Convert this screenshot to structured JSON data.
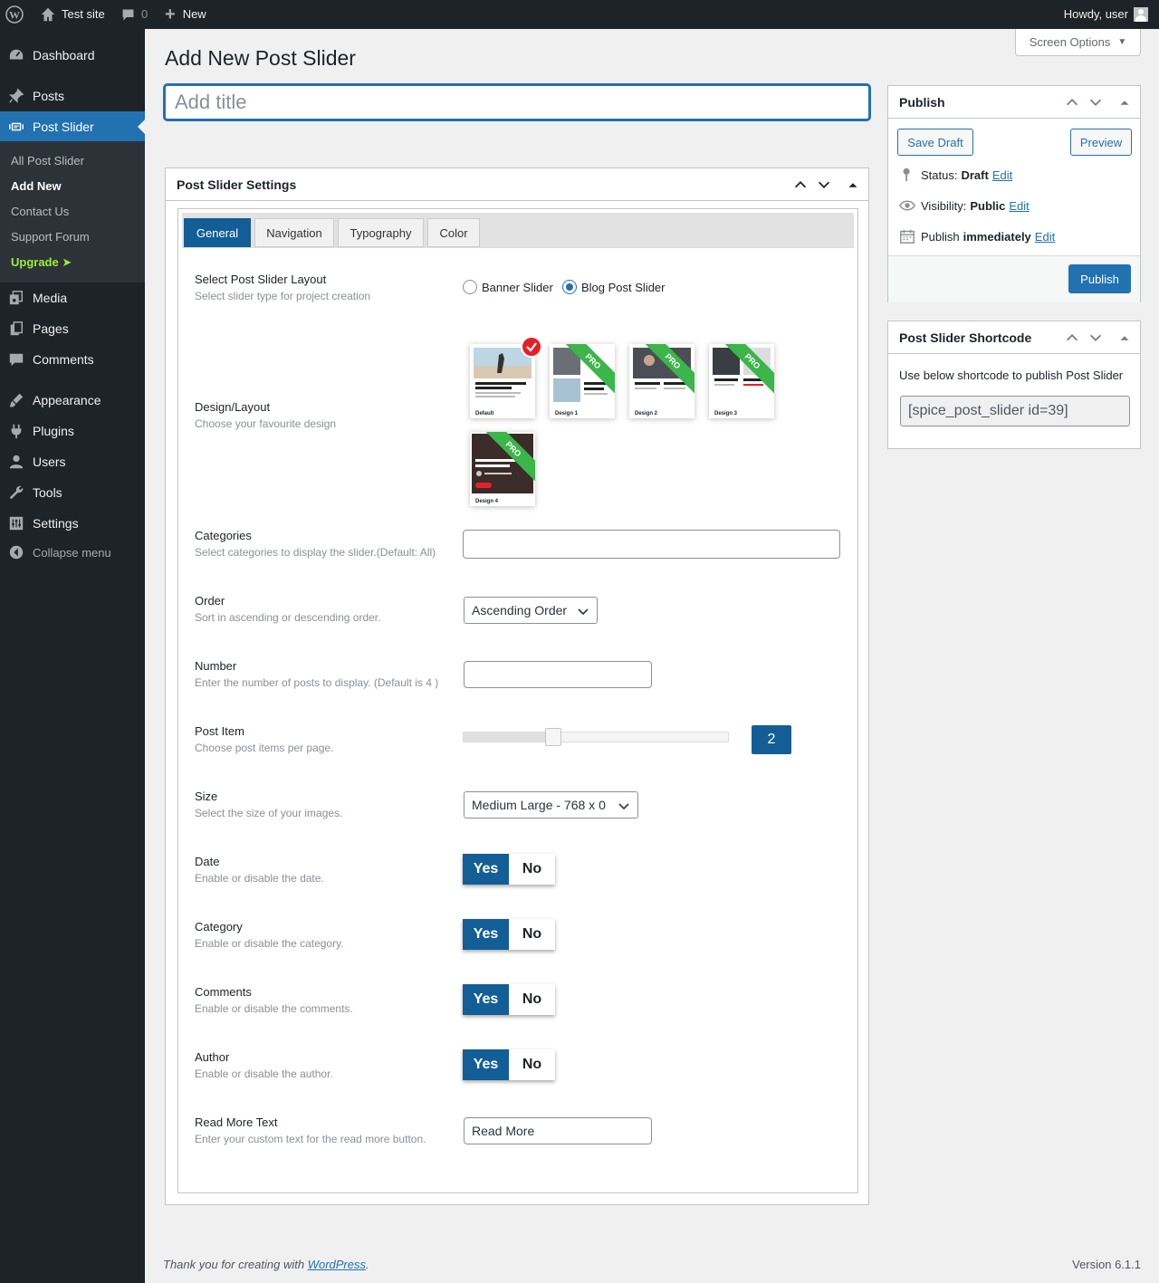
{
  "adminbar": {
    "site_name": "Test site",
    "comments_count": "0",
    "new_label": "New",
    "howdy": "Howdy, user"
  },
  "menu": {
    "items": [
      {
        "label": "Dashboard"
      },
      {
        "label": "Posts"
      },
      {
        "label": "Post Slider"
      },
      {
        "label": "Media"
      },
      {
        "label": "Pages"
      },
      {
        "label": "Comments"
      },
      {
        "label": "Appearance"
      },
      {
        "label": "Plugins"
      },
      {
        "label": "Users"
      },
      {
        "label": "Tools"
      },
      {
        "label": "Settings"
      },
      {
        "label": "Collapse menu"
      }
    ],
    "submenu": [
      {
        "label": "All Post Slider"
      },
      {
        "label": "Add New"
      },
      {
        "label": "Contact Us"
      },
      {
        "label": "Support Forum"
      },
      {
        "label": "Upgrade ➤"
      }
    ]
  },
  "screen_options": "Screen Options",
  "page_title": "Add New Post Slider",
  "title_placeholder": "Add title",
  "settings": {
    "title": "Post Slider Settings",
    "tabs": [
      "General",
      "Navigation",
      "Typography",
      "Color"
    ],
    "layout": {
      "label": "Select Post Slider Layout",
      "desc": "Select slider type for project creation",
      "options": [
        "Banner Slider",
        "Blog Post Slider"
      ],
      "selected": "Blog Post Slider"
    },
    "design": {
      "label": "Design/Layout",
      "desc": "Choose your favourite design",
      "items": [
        {
          "name": "Default",
          "pro": false,
          "selected": true
        },
        {
          "name": "Design 1",
          "pro": true
        },
        {
          "name": "Design 2",
          "pro": true
        },
        {
          "name": "Design 3",
          "pro": true
        },
        {
          "name": "Design 4",
          "pro": true
        }
      ],
      "pro_label": "PRO"
    },
    "categories": {
      "label": "Categories",
      "desc": "Select categories to display the slider.(Default: All)",
      "value": ""
    },
    "order": {
      "label": "Order",
      "desc": "Sort in ascending or descending order.",
      "value": "Ascending Order"
    },
    "number": {
      "label": "Number",
      "desc": "Enter the number of posts to display. (Default is 4 )",
      "value": ""
    },
    "post_item": {
      "label": "Post Item",
      "desc": "Choose post items per page.",
      "value": "2",
      "fraction": 0.33
    },
    "size": {
      "label": "Size",
      "desc": "Select the size of your images.",
      "value": "Medium Large - 768 x 0"
    },
    "date": {
      "label": "Date",
      "desc": "Enable or disable the date.",
      "yes": "Yes",
      "no": "No"
    },
    "category": {
      "label": "Category",
      "desc": "Enable or disable the category.",
      "yes": "Yes",
      "no": "No"
    },
    "comments": {
      "label": "Comments",
      "desc": "Enable or disable the comments.",
      "yes": "Yes",
      "no": "No"
    },
    "author": {
      "label": "Author",
      "desc": "Enable or disable the author.",
      "yes": "Yes",
      "no": "No"
    },
    "read_more": {
      "label": "Read More Text",
      "desc": "Enter your custom text for the read more button.",
      "value": "Read More"
    }
  },
  "publish": {
    "title": "Publish",
    "save_draft": "Save Draft",
    "preview": "Preview",
    "status_label": "Status:",
    "status_value": "Draft",
    "visibility_label": "Visibility:",
    "visibility_value": "Public",
    "publish_label": "Publish",
    "publish_value": "immediately",
    "edit": "Edit",
    "publish_button": "Publish"
  },
  "shortcode": {
    "title": "Post Slider Shortcode",
    "desc": "Use below shortcode to publish Post Slider",
    "value": "[spice_post_slider id=39]"
  },
  "footer": {
    "thanks_prefix": "Thank you for creating with ",
    "thanks_link": "WordPress",
    "thanks_suffix": ".",
    "version": "Version 6.1.1"
  }
}
